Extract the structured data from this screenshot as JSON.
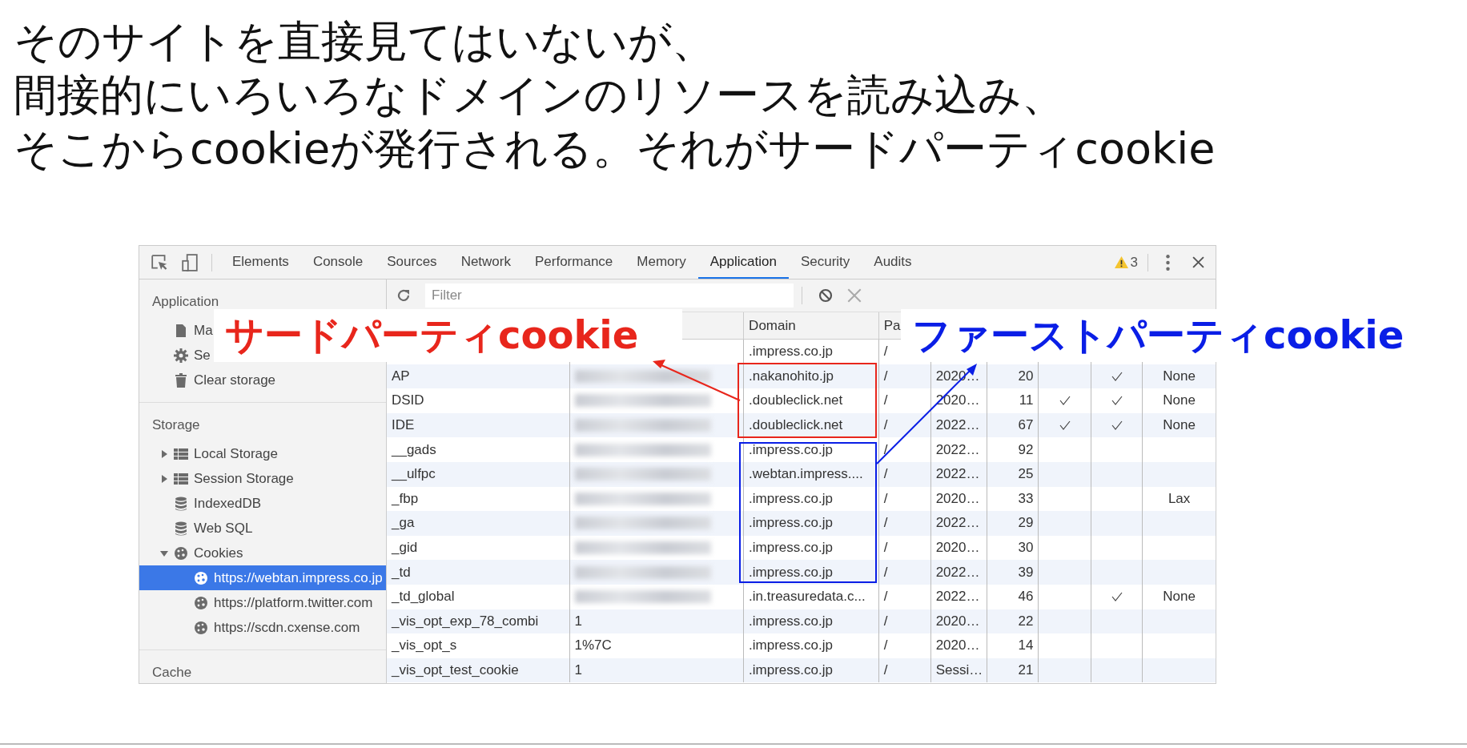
{
  "heading": {
    "lines": [
      "そのサイトを直接見てはいないが、",
      "間接的にいろいろなドメインのリソースを読み込み、",
      "そこからcookieが発行される。それがサードパーティcookie"
    ]
  },
  "devtools": {
    "tabs": [
      {
        "label": "Elements",
        "selected": false
      },
      {
        "label": "Console",
        "selected": false
      },
      {
        "label": "Sources",
        "selected": false
      },
      {
        "label": "Network",
        "selected": false
      },
      {
        "label": "Performance",
        "selected": false
      },
      {
        "label": "Memory",
        "selected": false
      },
      {
        "label": "Application",
        "selected": true
      },
      {
        "label": "Security",
        "selected": false
      },
      {
        "label": "Audits",
        "selected": false
      }
    ],
    "warning_count": "3",
    "filter": {
      "placeholder": "Filter"
    },
    "sidebar": {
      "sections": [
        {
          "title": "Application",
          "items": [
            {
              "kind": "document",
              "label": "Ma",
              "selected": false
            },
            {
              "kind": "gear",
              "label": "Se",
              "selected": false
            },
            {
              "kind": "trash",
              "label": "Clear storage",
              "selected": false
            }
          ]
        },
        {
          "title": "Storage",
          "items": [
            {
              "kind": "grid",
              "label": "Local Storage",
              "selected": false,
              "expanded": false
            },
            {
              "kind": "grid",
              "label": "Session Storage",
              "selected": false,
              "expanded": false
            },
            {
              "kind": "database",
              "label": "IndexedDB",
              "selected": false
            },
            {
              "kind": "database",
              "label": "Web SQL",
              "selected": false
            },
            {
              "kind": "cookie",
              "label": "Cookies",
              "selected": false,
              "expanded": true,
              "children": [
                {
                  "kind": "cookie",
                  "label": "https://webtan.impress.co.jp",
                  "selected": true
                },
                {
                  "kind": "cookie",
                  "label": "https://platform.twitter.com",
                  "selected": false
                },
                {
                  "kind": "cookie",
                  "label": "https://scdn.cxense.com",
                  "selected": false
                }
              ]
            }
          ]
        },
        {
          "title": "Cache"
        }
      ]
    },
    "table": {
      "header": {
        "domain": "Domain",
        "path": "Pa"
      },
      "rows": [
        {
          "domain": ".impress.co.jp",
          "path": "/"
        },
        {
          "name": "AP",
          "blurred": true,
          "domain": ".nakanohito.jp",
          "path": "/",
          "expires": "2020…",
          "size": "20",
          "http_only": false,
          "secure": true,
          "samesite": "None"
        },
        {
          "name": "DSID",
          "blurred": true,
          "domain": ".doubleclick.net",
          "path": "/",
          "expires": "2020…",
          "size": "11",
          "http_only": true,
          "secure": true,
          "samesite": "None"
        },
        {
          "name": "IDE",
          "blurred": true,
          "domain": ".doubleclick.net",
          "path": "/",
          "expires": "2022…",
          "size": "67",
          "http_only": true,
          "secure": true,
          "samesite": "None"
        },
        {
          "name": "__gads",
          "blurred": true,
          "domain": ".impress.co.jp",
          "path": "/",
          "expires": "2022…",
          "size": "92",
          "http_only": false,
          "secure": false
        },
        {
          "name": "__ulfpc",
          "blurred": true,
          "domain": ".webtan.impress....",
          "path": "/",
          "expires": "2022…",
          "size": "25",
          "http_only": false,
          "secure": false
        },
        {
          "name": "_fbp",
          "blurred": true,
          "domain": ".impress.co.jp",
          "path": "/",
          "expires": "2020…",
          "size": "33",
          "http_only": false,
          "secure": false,
          "samesite": "Lax"
        },
        {
          "name": "_ga",
          "blurred": true,
          "domain": ".impress.co.jp",
          "path": "/",
          "expires": "2022…",
          "size": "29",
          "http_only": false,
          "secure": false
        },
        {
          "name": "_gid",
          "blurred": true,
          "domain": ".impress.co.jp",
          "path": "/",
          "expires": "2020…",
          "size": "30",
          "http_only": false,
          "secure": false
        },
        {
          "name": "_td",
          "blurred": true,
          "domain": ".impress.co.jp",
          "path": "/",
          "expires": "2022…",
          "size": "39",
          "http_only": false,
          "secure": false
        },
        {
          "name": "_td_global",
          "blurred": true,
          "domain": ".in.treasuredata.c...",
          "path": "/",
          "expires": "2022…",
          "size": "46",
          "http_only": false,
          "secure": true,
          "samesite": "None"
        },
        {
          "name": "_vis_opt_exp_78_combi",
          "value": "1",
          "domain": ".impress.co.jp",
          "path": "/",
          "expires": "2020…",
          "size": "22",
          "http_only": false,
          "secure": false
        },
        {
          "name": "_vis_opt_s",
          "value": "1%7C",
          "domain": ".impress.co.jp",
          "path": "/",
          "expires": "2020…",
          "size": "14",
          "http_only": false,
          "secure": false
        },
        {
          "name": "_vis_opt_test_cookie",
          "value": "1",
          "domain": ".impress.co.jp",
          "path": "/",
          "expires": "Sessi…",
          "size": "21",
          "http_only": false,
          "secure": false
        }
      ]
    }
  },
  "annotations": [
    {
      "kind": "third_party",
      "label": "サードパーティcookie",
      "color": "#e8261c"
    },
    {
      "kind": "first_party",
      "label": "ファーストパーティcookie",
      "color": "#0a1ee6"
    }
  ]
}
